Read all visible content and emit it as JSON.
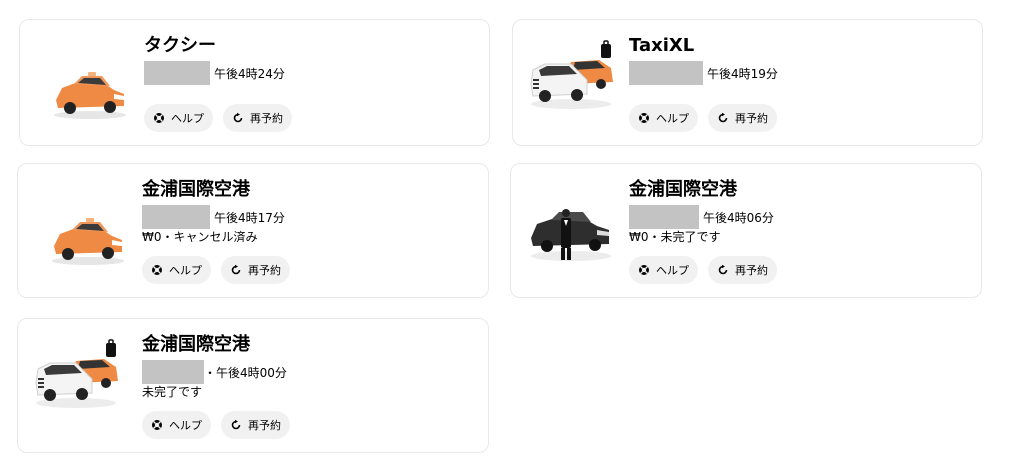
{
  "trips": [
    {
      "title": "タクシー",
      "time": "午後4時24分",
      "status": "",
      "vehicle_icon": "orange-taxi-icon",
      "help_label": "ヘルプ",
      "rebook_label": "再予約"
    },
    {
      "title": "TaxiXL",
      "time": "午後4時19分",
      "status": "",
      "vehicle_icon": "taxi-xl-icon",
      "help_label": "ヘルプ",
      "rebook_label": "再予約"
    },
    {
      "title": "金浦国際空港",
      "time": "午後4時17分",
      "status": "₩0・キャンセル済み",
      "vehicle_icon": "orange-taxi-icon",
      "help_label": "ヘルプ",
      "rebook_label": "再予約"
    },
    {
      "title": "金浦国際空港",
      "time": "午後4時06分",
      "status": "₩0・未完了です",
      "vehicle_icon": "black-car-with-chauffeur-icon",
      "help_label": "ヘルプ",
      "rebook_label": "再予約"
    },
    {
      "title": "金浦国際空港",
      "time": "・午後4時00分",
      "status": "未完了です",
      "vehicle_icon": "taxi-xl-icon",
      "help_label": "ヘルプ",
      "rebook_label": "再予約"
    }
  ],
  "colors": {
    "orange": "#ee8a44",
    "redacted": "#c3c3c3",
    "pill_bg": "#f1f1f1",
    "border": "#e8e8e8"
  }
}
